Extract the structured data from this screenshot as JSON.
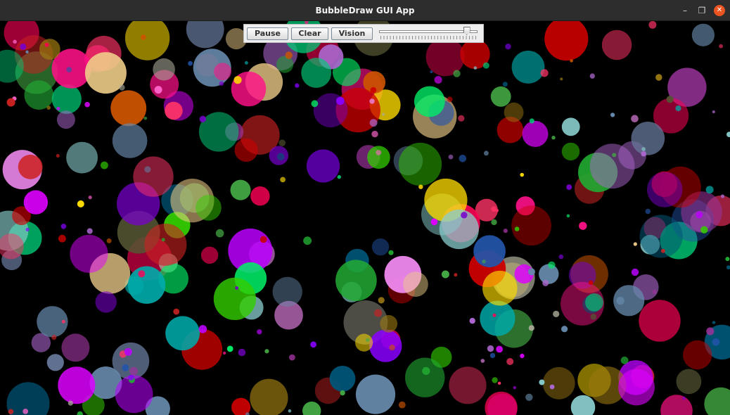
{
  "window": {
    "title": "BubbleDraw GUI App"
  },
  "window_controls": {
    "minimize": "–",
    "maximize": "❐",
    "close": "✕"
  },
  "toolbar": {
    "pause_label": "Pause",
    "clear_label": "Clear",
    "vision_label": "Vision"
  },
  "speed_slider": {
    "value": 0.92
  },
  "canvas": {
    "background": "#000000"
  },
  "palette": [
    "#ff66cc",
    "#22aa33",
    "#00aaaa",
    "#8800ff",
    "#cc2222",
    "#ff0055",
    "#00cc77",
    "#eecc88",
    "#bb00ff",
    "#ffdd00",
    "#6688aa",
    "#aa66cc",
    "#33cc00",
    "#997711",
    "#ff1188",
    "#2255aa",
    "#88cccc",
    "#cc0000",
    "#7700cc",
    "#44aa44",
    "#dd00ff",
    "#aaaa99",
    "#667799",
    "#ff3366",
    "#005577",
    "#00ee66",
    "#993399",
    "#cc5500",
    "#555533",
    "#ee88ee"
  ]
}
